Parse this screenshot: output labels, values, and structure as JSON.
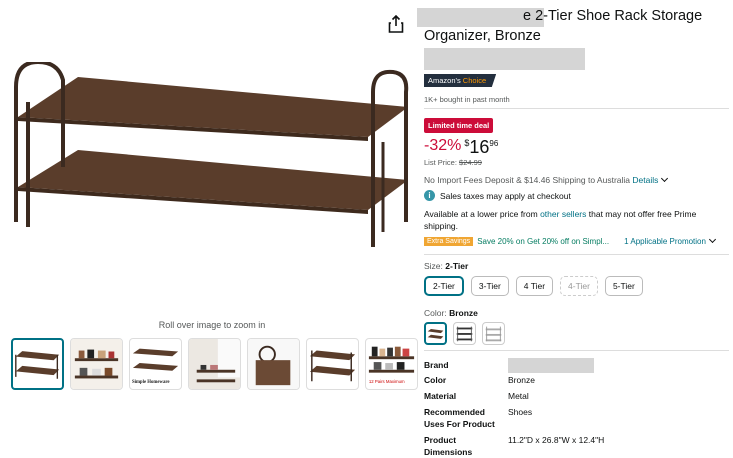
{
  "product": {
    "title_line1": "e 2-Tier Shoe Rack Storage",
    "title_line2": "Organizer, Bronze",
    "badge_prefix": "Amazon's",
    "badge_suffix": "Choice",
    "bought": "1K+ bought in past month",
    "deal_badge": "Limited time deal",
    "discount": "-32%",
    "currency": "$",
    "price_whole": "16",
    "price_fraction": "96",
    "list_price_label": "List Price:",
    "list_price": "$24.99",
    "shipping_text": "No Import Fees Deposit & $14.46 Shipping to Australia",
    "details_link": "Details",
    "tax_text": "Sales taxes may apply at checkout",
    "lower_prefix": "Available at a lower price from",
    "lower_link": "other sellers",
    "lower_suffix": "that may not offer free Prime shipping.",
    "extra_savings": "Extra Savings",
    "promo_text": "Save 20% on Get 20% off on Simpl...",
    "applicable_promo": "1 Applicable Promotion"
  },
  "size": {
    "label": "Size:",
    "selected": "2-Tier",
    "options": [
      "2-Tier",
      "3-Tier",
      "4 Tier",
      "4-Tier",
      "5-Tier"
    ]
  },
  "color": {
    "label": "Color:",
    "selected": "Bronze"
  },
  "media": {
    "zoom_hint": "Roll over image to zoom in",
    "thumb2_text": "Simple Homeware",
    "thumb7_text": "12 Pairs Maximum"
  },
  "specs": [
    {
      "key": "Brand",
      "value": ""
    },
    {
      "key": "Color",
      "value": "Bronze"
    },
    {
      "key": "Material",
      "value": "Metal"
    },
    {
      "key": "Recommended Uses For Product",
      "value": "Shoes"
    },
    {
      "key": "Product Dimensions",
      "value": "11.2\"D x 26.8\"W x 12.4\"H"
    }
  ],
  "colors": {
    "accent": "#007185",
    "deal_red": "#cc0c39",
    "rack_bronze": "#5a3d2b",
    "promo_green": "#067d62"
  }
}
